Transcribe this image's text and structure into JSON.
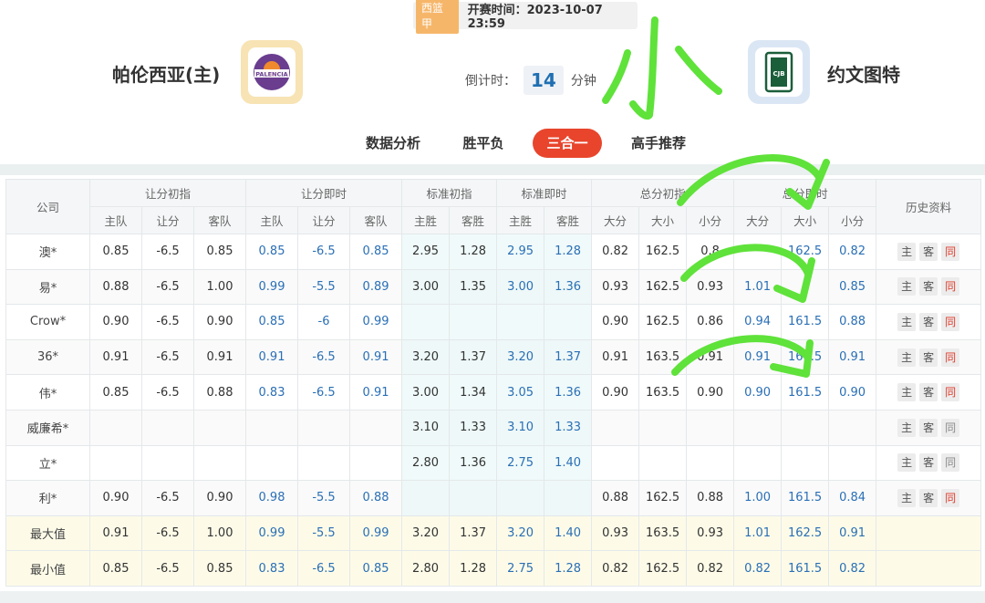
{
  "header": {
    "league": "西篮甲",
    "start_time": "开赛时间：2023-10-07 23:59",
    "home_team": "帕伦西亚(主)",
    "away_team": "约文图特",
    "home_logo_text": "PALENCIA",
    "away_logo_text": "CJB",
    "countdown_label": "倒计时：",
    "countdown_value": "14",
    "countdown_unit": "分钟"
  },
  "annotation_text": "小",
  "tabs": [
    {
      "label": "数据分析",
      "active": false
    },
    {
      "label": "胜平负",
      "active": false
    },
    {
      "label": "三合一",
      "active": true
    },
    {
      "label": "高手推荐",
      "active": false
    }
  ],
  "table": {
    "col_company": "公司",
    "col_history": "历史资料",
    "groups": [
      "让分初指",
      "让分即时",
      "标准初指",
      "标准即时",
      "总分初指",
      "总分即时"
    ],
    "sub_handicap": [
      "主队",
      "让分",
      "客队"
    ],
    "sub_standard": [
      "主胜",
      "客胜"
    ],
    "sub_total": [
      "大分",
      "大小",
      "小分"
    ],
    "hist_buttons": [
      "主",
      "客",
      "同"
    ],
    "rows": [
      {
        "company": "澳*",
        "v": [
          "0.85",
          "-6.5",
          "0.85",
          "0.85",
          "-6.5",
          "0.85",
          "2.95",
          "1.28",
          "2.95",
          "1.28",
          "0.82",
          "162.5",
          "0.8",
          "",
          "162.5",
          "0.82"
        ],
        "same_red": true
      },
      {
        "company": "易*",
        "v": [
          "0.88",
          "-6.5",
          "1.00",
          "0.99",
          "-5.5",
          "0.89",
          "3.00",
          "1.35",
          "3.00",
          "1.36",
          "0.93",
          "162.5",
          "0.93",
          "1.01",
          "",
          "0.85"
        ],
        "same_red": true
      },
      {
        "company": "Crow*",
        "v": [
          "0.90",
          "-6.5",
          "0.90",
          "0.85",
          "-6",
          "0.99",
          "",
          "",
          "",
          "",
          "0.90",
          "162.5",
          "0.86",
          "0.94",
          "161.5",
          "0.88"
        ],
        "same_red": true
      },
      {
        "company": "36*",
        "v": [
          "0.91",
          "-6.5",
          "0.91",
          "0.91",
          "-6.5",
          "0.91",
          "3.20",
          "1.37",
          "3.20",
          "1.37",
          "0.91",
          "163.5",
          "0.91",
          "0.91",
          "161.5",
          "0.91"
        ],
        "same_red": true
      },
      {
        "company": "伟*",
        "v": [
          "0.85",
          "-6.5",
          "0.88",
          "0.83",
          "-6.5",
          "0.91",
          "3.00",
          "1.34",
          "3.05",
          "1.36",
          "0.90",
          "163.5",
          "0.90",
          "0.90",
          "161.5",
          "0.90"
        ],
        "same_red": true
      },
      {
        "company": "威廉希*",
        "v": [
          "",
          "",
          "",
          "",
          "",
          "",
          "3.10",
          "1.33",
          "3.10",
          "1.33",
          "",
          "",
          "",
          "",
          "",
          ""
        ],
        "same_red": false
      },
      {
        "company": "立*",
        "v": [
          "",
          "",
          "",
          "",
          "",
          "",
          "2.80",
          "1.36",
          "2.75",
          "1.40",
          "",
          "",
          "",
          "",
          "",
          ""
        ],
        "same_red": false
      },
      {
        "company": "利*",
        "v": [
          "0.90",
          "-6.5",
          "0.90",
          "0.98",
          "-5.5",
          "0.88",
          "",
          "",
          "",
          "",
          "0.88",
          "162.5",
          "0.88",
          "1.00",
          "161.5",
          "0.84"
        ],
        "same_red": true
      }
    ],
    "summary": [
      {
        "label": "最大值",
        "v": [
          "0.91",
          "-6.5",
          "1.00",
          "0.99",
          "-5.5",
          "0.99",
          "3.20",
          "1.37",
          "3.20",
          "1.40",
          "0.93",
          "163.5",
          "0.93",
          "1.01",
          "162.5",
          "0.91"
        ]
      },
      {
        "label": "最小值",
        "v": [
          "0.85",
          "-6.5",
          "0.85",
          "0.83",
          "-6.5",
          "0.85",
          "2.80",
          "1.28",
          "2.75",
          "1.28",
          "0.82",
          "162.5",
          "0.82",
          "0.82",
          "161.5",
          "0.82"
        ]
      }
    ]
  }
}
